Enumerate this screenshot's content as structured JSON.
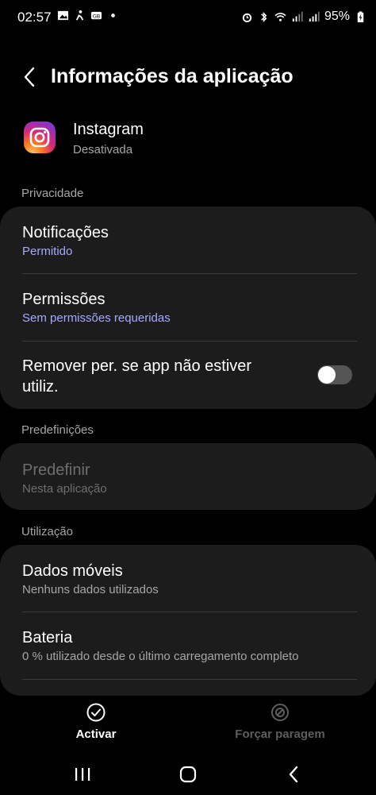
{
  "status_bar": {
    "time": "02:57",
    "battery": "95%"
  },
  "header": {
    "title": "Informações da aplicação"
  },
  "app": {
    "name": "Instagram",
    "status": "Desativada"
  },
  "sections": {
    "privacy": "Privacidade",
    "defaults": "Predefinições",
    "usage": "Utilização"
  },
  "privacy": {
    "notifications_title": "Notificações",
    "notifications_sub": "Permitido",
    "permissions_title": "Permissões",
    "permissions_sub": "Sem permissões requeridas",
    "remove_perms_line1": "Remover per. se app não estiver",
    "remove_perms_line2": "utiliz.",
    "remove_perms_enabled": false
  },
  "defaults": {
    "set_default_title": "Predefinir",
    "set_default_sub": "Nesta aplicação"
  },
  "usage": {
    "mobile_data_title": "Dados móveis",
    "mobile_data_sub": "Nenhuns dados utilizados",
    "battery_title": "Bateria",
    "battery_sub": "0 % utilizado desde o último carregamento completo"
  },
  "actions": {
    "activate": "Activar",
    "force_stop": "Forçar paragem"
  },
  "colors": {
    "accent_sub": "#a8a8ff",
    "card_bg": "#1c1c1c",
    "disabled_text": "#6e6e6e"
  }
}
